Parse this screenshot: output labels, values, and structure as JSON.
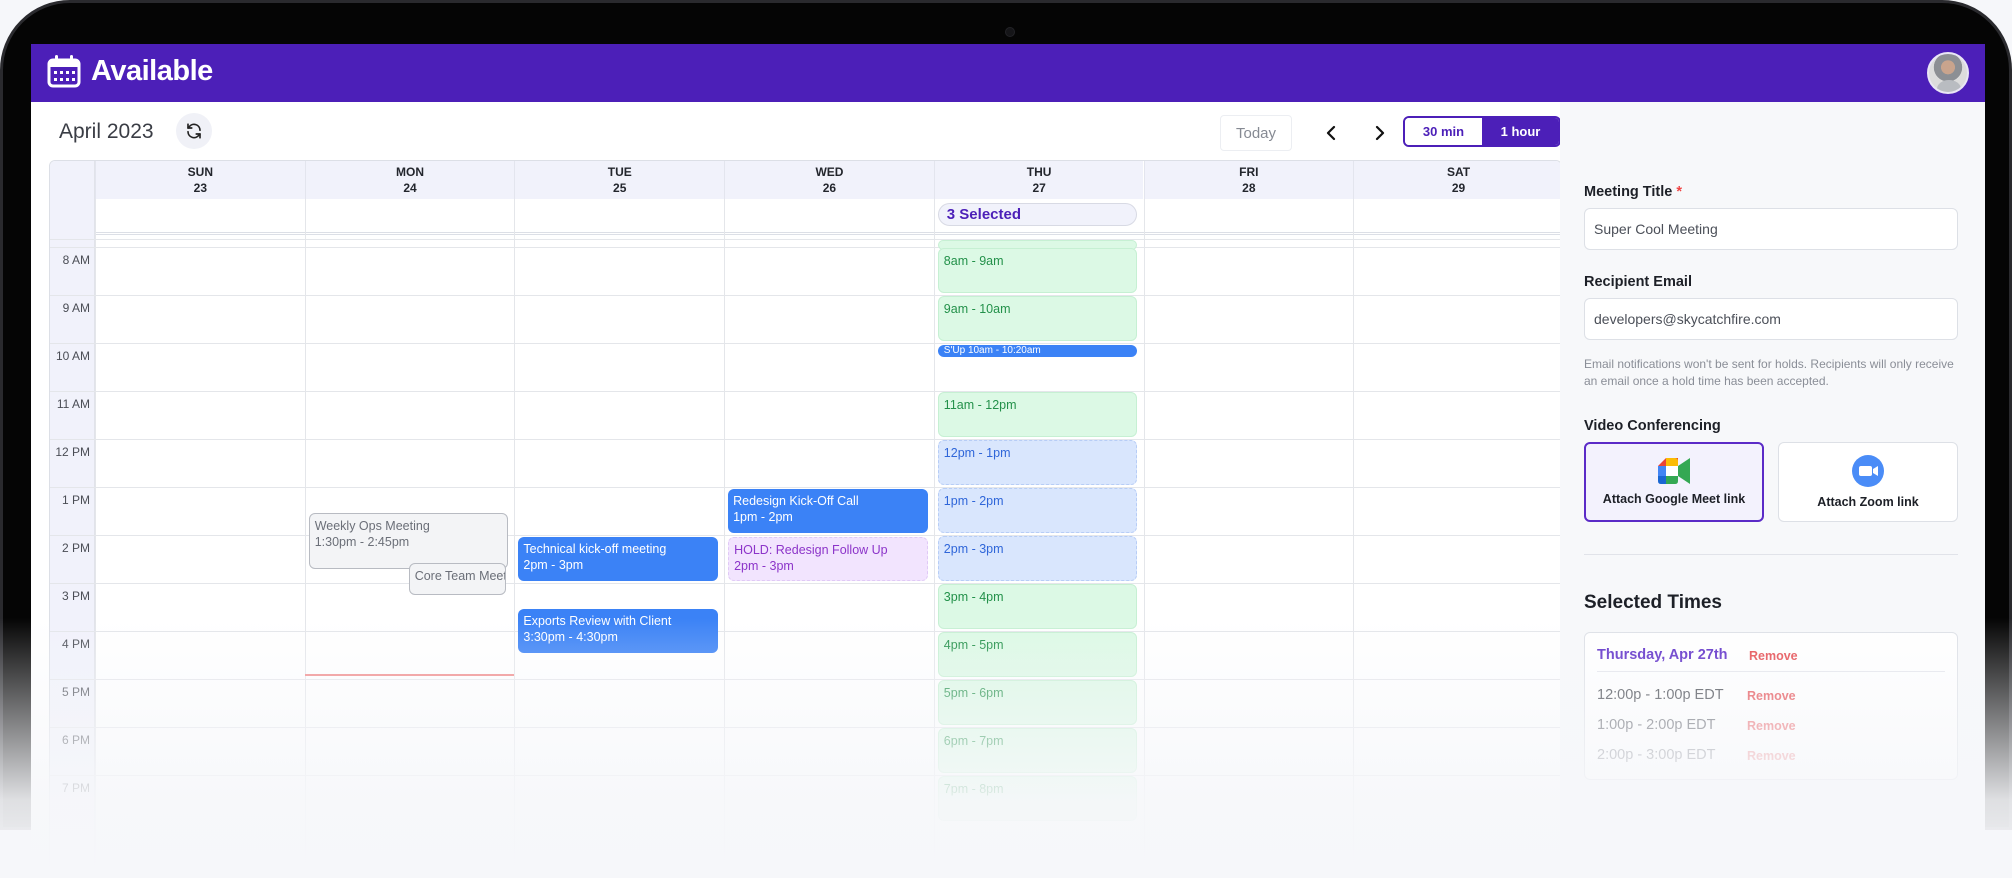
{
  "app": {
    "name": "Available",
    "brand_icon": "calendar-icon",
    "avatar": "user-avatar"
  },
  "toolbar": {
    "month_label": "April 2023",
    "refresh_icon": "refresh-icon",
    "today_label": "Today",
    "prev_icon": "chevron-left-icon",
    "next_icon": "chevron-right-icon",
    "durations": [
      {
        "label": "30 min",
        "active": false
      },
      {
        "label": "1 hour",
        "active": true
      }
    ]
  },
  "calendar": {
    "days": [
      {
        "dow": "SUN",
        "date": "23"
      },
      {
        "dow": "MON",
        "date": "24"
      },
      {
        "dow": "TUE",
        "date": "25"
      },
      {
        "dow": "WED",
        "date": "26"
      },
      {
        "dow": "THU",
        "date": "27"
      },
      {
        "dow": "FRI",
        "date": "28"
      },
      {
        "dow": "SAT",
        "date": "29"
      }
    ],
    "hours": [
      "8 AM",
      "9 AM",
      "10 AM",
      "11 AM",
      "12 PM",
      "1 PM",
      "2 PM",
      "3 PM",
      "4 PM",
      "5 PM",
      "6 PM",
      "7 PM"
    ],
    "selected_badge": {
      "day": 4,
      "label": "3 Selected"
    },
    "availability_slots": [
      {
        "day": 4,
        "start": 7.0,
        "end": 8.0,
        "label": "",
        "style": "green"
      },
      {
        "day": 4,
        "start": 8.0,
        "end": 9.0,
        "label": "8am - 9am",
        "style": "green"
      },
      {
        "day": 4,
        "start": 9.0,
        "end": 10.0,
        "label": "9am - 10am",
        "style": "green"
      },
      {
        "day": 4,
        "start": 11.0,
        "end": 12.0,
        "label": "11am - 12pm",
        "style": "green"
      },
      {
        "day": 4,
        "start": 12.0,
        "end": 13.0,
        "label": "12pm - 1pm",
        "style": "blue-sel"
      },
      {
        "day": 4,
        "start": 13.0,
        "end": 14.0,
        "label": "1pm - 2pm",
        "style": "blue-sel"
      },
      {
        "day": 4,
        "start": 14.0,
        "end": 15.0,
        "label": "2pm - 3pm",
        "style": "blue-sel"
      },
      {
        "day": 4,
        "start": 15.0,
        "end": 16.0,
        "label": "3pm - 4pm",
        "style": "green"
      },
      {
        "day": 4,
        "start": 16.0,
        "end": 17.0,
        "label": "4pm - 5pm",
        "style": "green"
      },
      {
        "day": 4,
        "start": 17.0,
        "end": 18.0,
        "label": "5pm - 6pm",
        "style": "green"
      },
      {
        "day": 4,
        "start": 18.0,
        "end": 19.0,
        "label": "6pm - 7pm",
        "style": "green"
      },
      {
        "day": 4,
        "start": 19.0,
        "end": 20.0,
        "label": "7pm - 8pm",
        "style": "green"
      }
    ],
    "events": [
      {
        "day": 4,
        "start": 10.0,
        "end": 10.33,
        "title": "S'Up",
        "time": "10am - 10:20am",
        "style": "pill"
      },
      {
        "day": 1,
        "start": 13.5,
        "end": 14.75,
        "title": "Weekly Ops Meeting",
        "time": "1:30pm - 2:45pm",
        "style": "gray"
      },
      {
        "day": 1,
        "start": 14.0,
        "end": 15.0,
        "title": "Core Team Meet",
        "time": "",
        "style": "gray",
        "offset": true
      },
      {
        "day": 2,
        "start": 14.0,
        "end": 15.0,
        "title": "Technical kick-off meeting",
        "time": "2pm - 3pm",
        "style": "solid"
      },
      {
        "day": 2,
        "start": 15.5,
        "end": 16.5,
        "title": "Exports Review with Client",
        "time": "3:30pm - 4:30pm",
        "style": "solid"
      },
      {
        "day": 3,
        "start": 13.0,
        "end": 14.0,
        "title": "Redesign Kick-Off Call",
        "time": "1pm - 2pm",
        "style": "solid"
      },
      {
        "day": 3,
        "start": 14.0,
        "end": 15.0,
        "title": "HOLD: Redesign Follow Up",
        "time": "2pm - 3pm",
        "style": "hold"
      }
    ],
    "now_indicator": {
      "day": 1,
      "hour": 16.9
    }
  },
  "form": {
    "meeting_title_label": "Meeting Title",
    "required_mark": "*",
    "meeting_title_value": "Super Cool Meeting",
    "recipient_email_label": "Recipient Email",
    "recipient_email_value": "developers@skycatchfire.com",
    "email_hint": "Email notifications won't be sent for holds. Recipients will only receive an email once a hold time has been accepted.",
    "video_label": "Video Conferencing",
    "video_options": [
      {
        "label": "Attach Google Meet link",
        "icon": "google-meet-icon",
        "selected": true
      },
      {
        "label": "Attach Zoom link",
        "icon": "zoom-icon",
        "selected": false
      }
    ]
  },
  "selected_times": {
    "title": "Selected Times",
    "day_label": "Thursday, Apr 27th",
    "remove_label": "Remove",
    "slots": [
      {
        "label": "12:00p - 1:00p EDT",
        "remove": "Remove"
      },
      {
        "label": "1:00p - 2:00p EDT",
        "remove": "Remove"
      },
      {
        "label": "2:00p - 3:00p EDT",
        "remove": "Remove"
      }
    ]
  },
  "colors": {
    "brand": "#4c1fb8",
    "event_blue": "#3b82f6",
    "available_green": "#dcf9e5",
    "hold_purple": "#f2e4fe",
    "remove_red": "#e5484d"
  }
}
